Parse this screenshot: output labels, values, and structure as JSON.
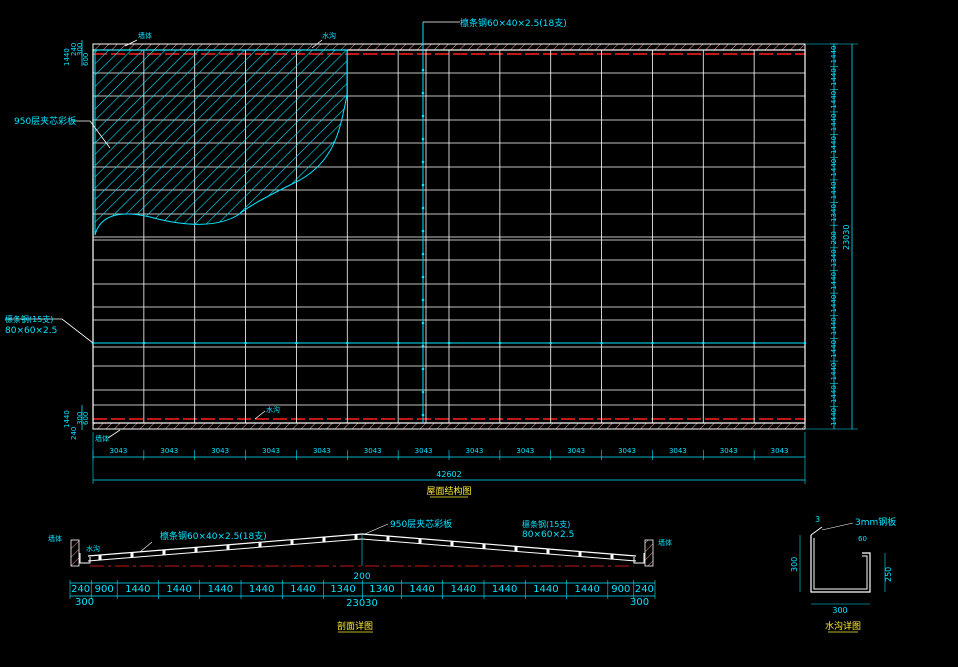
{
  "plan": {
    "labels": {
      "top_left_tag": "墙体",
      "top_gutter_tag": "水沟",
      "top_purlin": "檩条钢60×40×2.5(18支)",
      "sheet": "950层夹芯彩板",
      "truss_line1": "檩条钢(15支)",
      "truss_line2": "80×60×2.5",
      "bottom_gutter_tag": "水沟",
      "bottom_left_tag": "墙体"
    },
    "left_dims_top": [
      "1440",
      "240",
      "300",
      "600"
    ],
    "left_dims_bottom": [
      "1440",
      "240",
      "300",
      "600"
    ],
    "right_dims": [
      "1440",
      "1440",
      "1440",
      "1440",
      "1440",
      "1440",
      "1440",
      "1340",
      "200",
      "1340",
      "1440",
      "1440",
      "1440",
      "1440",
      "1440",
      "1440",
      "1440"
    ],
    "right_total": "23030",
    "bay_dims": [
      "3043",
      "3043",
      "3043",
      "3043",
      "3043",
      "3043",
      "3043",
      "3043",
      "3043",
      "3043",
      "3043",
      "3043",
      "3043",
      "3043"
    ],
    "total_length": "42602",
    "title": "屋面结构图"
  },
  "section": {
    "labels": {
      "left_tag": "墙体",
      "left_gutter": "水沟",
      "purlin": "檩条钢60×40×2.5(18支)",
      "sheet": "950层夹芯彩板",
      "truss_line1": "檩条钢(15支)",
      "truss_line2": "80×60×2.5",
      "right_tag": "墙体"
    },
    "ridge_dim": "200",
    "dims": [
      "240",
      "900",
      "1440",
      "1440",
      "1440",
      "1440",
      "1440",
      "1340",
      "1340",
      "1440",
      "1440",
      "1440",
      "1440",
      "1440",
      "900",
      "240"
    ],
    "end_left": "300",
    "total": "23030",
    "end_right": "300",
    "title": "剖面详图"
  },
  "gutter": {
    "label": "3mm钢板",
    "thk": "3",
    "lip": "60",
    "depth_left": "300",
    "depth_right": "250",
    "width": "300",
    "title": "水沟详图"
  },
  "colors": {
    "cyan": "#00e5ff",
    "white": "#ffffff",
    "red": "#ff2020",
    "yellow": "#ffee33",
    "hatch": "#00e5ff"
  }
}
